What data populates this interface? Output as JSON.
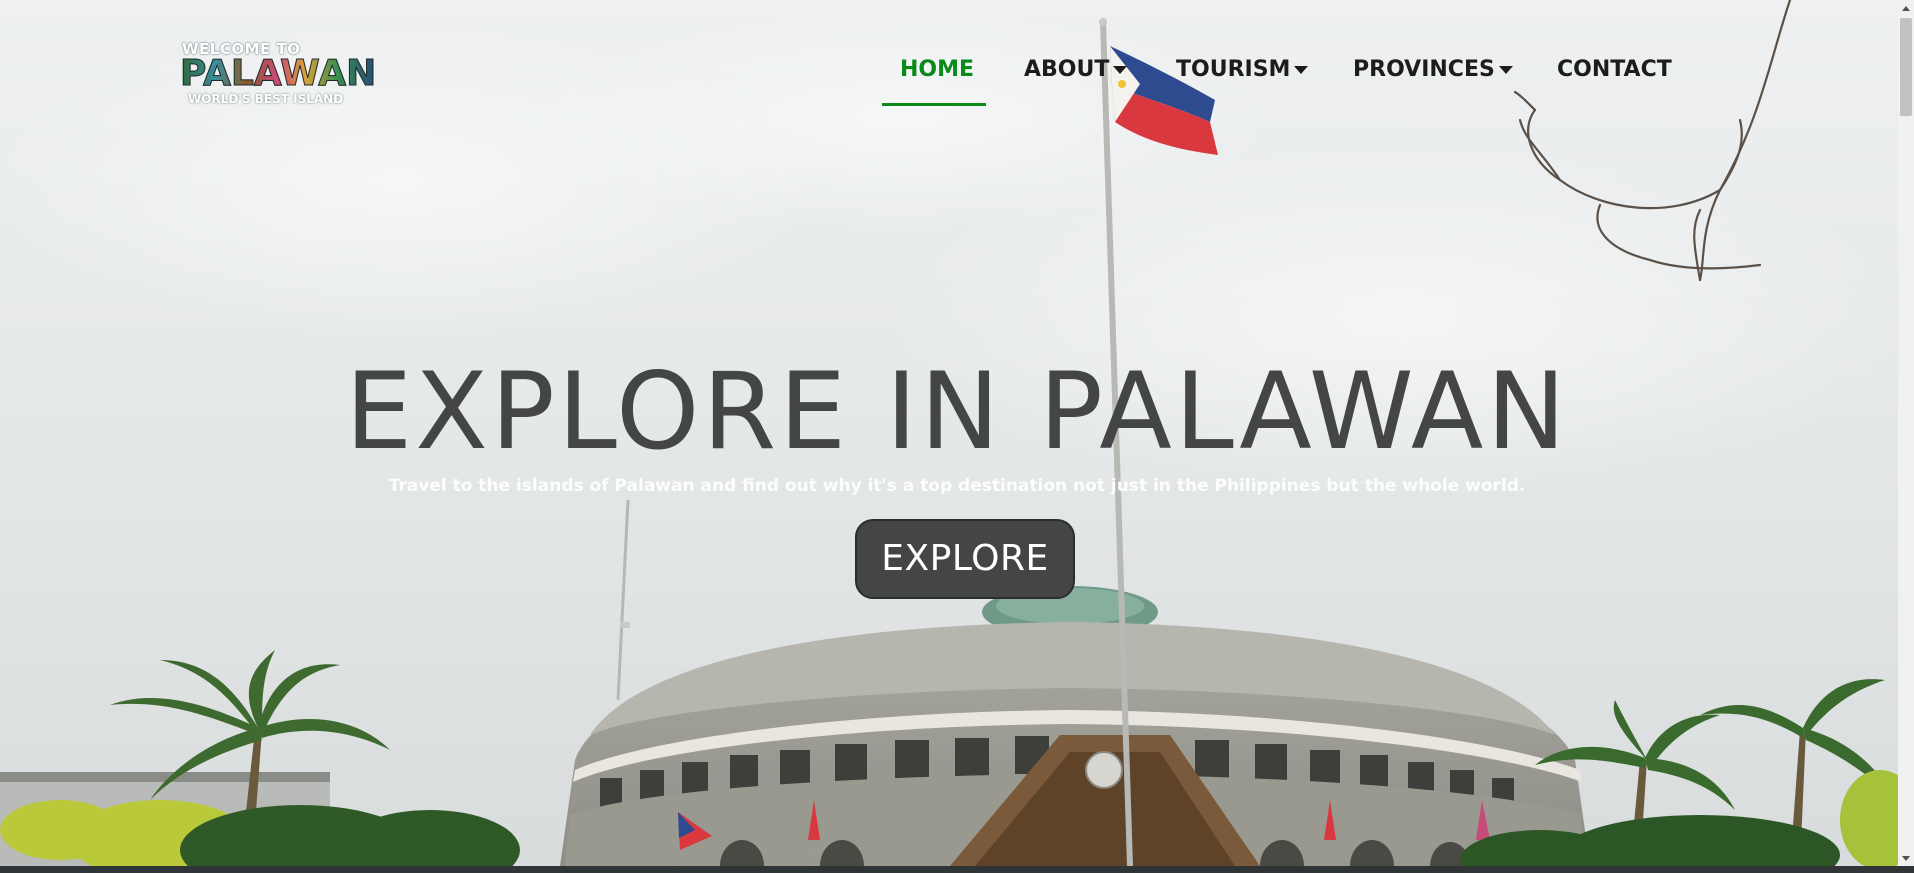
{
  "logo": {
    "top_text": "WELCOME TO",
    "main_text": "PALAWAN",
    "sub_text": "WORLD'S BEST ISLAND"
  },
  "nav": {
    "items": [
      {
        "label": "HOME",
        "active": true,
        "dropdown": false
      },
      {
        "label": "ABOUT",
        "active": false,
        "dropdown": true
      },
      {
        "label": "TOURISM",
        "active": false,
        "dropdown": true
      },
      {
        "label": "PROVINCES",
        "active": false,
        "dropdown": true
      },
      {
        "label": "CONTACT",
        "active": false,
        "dropdown": false
      }
    ]
  },
  "hero": {
    "title": "EXPLORE IN PALAWAN",
    "subtitle": "Travel to the islands of Palawan and find out why it's a top destination not just in the Philippines but the whole world.",
    "button_label": "EXPLORE"
  },
  "colors": {
    "active_nav": "#0b8a1c",
    "nav_text": "#1c1c1c",
    "title_text": "#444546",
    "button_bg": "#434546"
  },
  "icons": {
    "dropdown": "caret-down-icon"
  }
}
